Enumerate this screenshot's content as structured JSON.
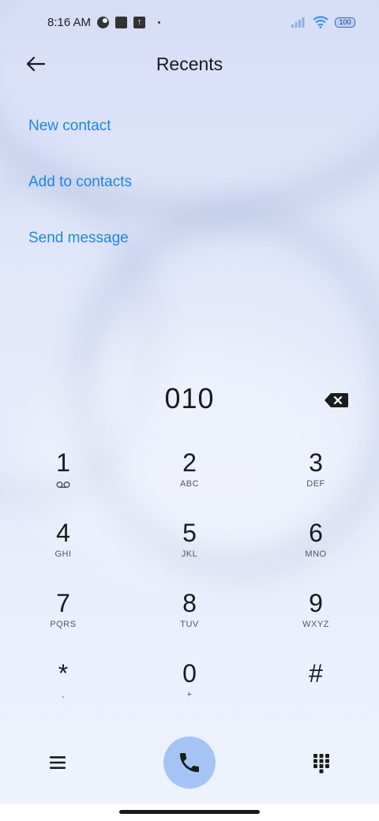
{
  "status_bar": {
    "time": "8:16 AM",
    "battery": "100",
    "icons": [
      "data-saver-icon",
      "square-notification-icon",
      "upload-icon",
      "dot-icon",
      "signal-icon",
      "wifi-icon",
      "battery-icon"
    ]
  },
  "header": {
    "title": "Recents",
    "back_icon": "arrow-left-icon"
  },
  "actions": {
    "new_contact": "New contact",
    "add_to_contacts": "Add to contacts",
    "send_message": "Send message"
  },
  "dialer": {
    "number": "010",
    "keys": [
      {
        "digit": "1",
        "letters": ""
      },
      {
        "digit": "2",
        "letters": "ABC"
      },
      {
        "digit": "3",
        "letters": "DEF"
      },
      {
        "digit": "4",
        "letters": "GHI"
      },
      {
        "digit": "5",
        "letters": "JKL"
      },
      {
        "digit": "6",
        "letters": "MNO"
      },
      {
        "digit": "7",
        "letters": "PQRS"
      },
      {
        "digit": "8",
        "letters": "TUV"
      },
      {
        "digit": "9",
        "letters": "WXYZ"
      },
      {
        "digit": "*",
        "letters": ","
      },
      {
        "digit": "0",
        "letters": "+"
      },
      {
        "digit": "#",
        "letters": ""
      }
    ]
  },
  "colors": {
    "accent": "#1a86e6",
    "call_button": "#a6c3f5",
    "text": "#1b1b1b"
  }
}
